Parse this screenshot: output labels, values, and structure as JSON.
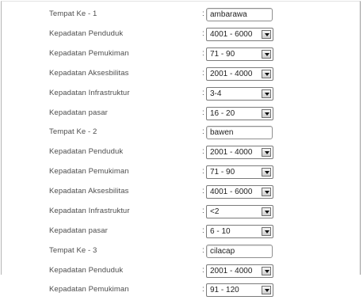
{
  "form": {
    "rows": [
      {
        "label": "Tempat Ke - 1",
        "type": "text",
        "value": "ambarawa"
      },
      {
        "label": "Kepadatan Penduduk",
        "type": "select",
        "value": "4001 - 6000"
      },
      {
        "label": "Kepadatan Pemukiman",
        "type": "select",
        "value": "71 - 90"
      },
      {
        "label": "Kepadatan Aksesbilitas",
        "type": "select",
        "value": "2001 - 4000"
      },
      {
        "label": "Kepadatan Infrastruktur",
        "type": "select",
        "value": "3-4"
      },
      {
        "label": "Kepadatan pasar",
        "type": "select",
        "value": "16 - 20"
      },
      {
        "label": "Tempat Ke - 2",
        "type": "text",
        "value": "bawen"
      },
      {
        "label": "Kepadatan Penduduk",
        "type": "select",
        "value": "2001 - 4000"
      },
      {
        "label": "Kepadatan Pemukiman",
        "type": "select",
        "value": "71 - 90"
      },
      {
        "label": "Kepadatan Aksesbilitas",
        "type": "select",
        "value": "4001 - 6000"
      },
      {
        "label": "Kepadatan Infrastruktur",
        "type": "select",
        "value": "<2"
      },
      {
        "label": "Kepadatan pasar",
        "type": "select",
        "value": "6 - 10"
      },
      {
        "label": "Tempat Ke - 3",
        "type": "text",
        "value": "cilacap"
      },
      {
        "label": "Kepadatan Penduduk",
        "type": "select",
        "value": "2001 - 4000"
      },
      {
        "label": "Kepadatan Pemukiman",
        "type": "select",
        "value": "91 - 120"
      }
    ],
    "separator": ":"
  }
}
